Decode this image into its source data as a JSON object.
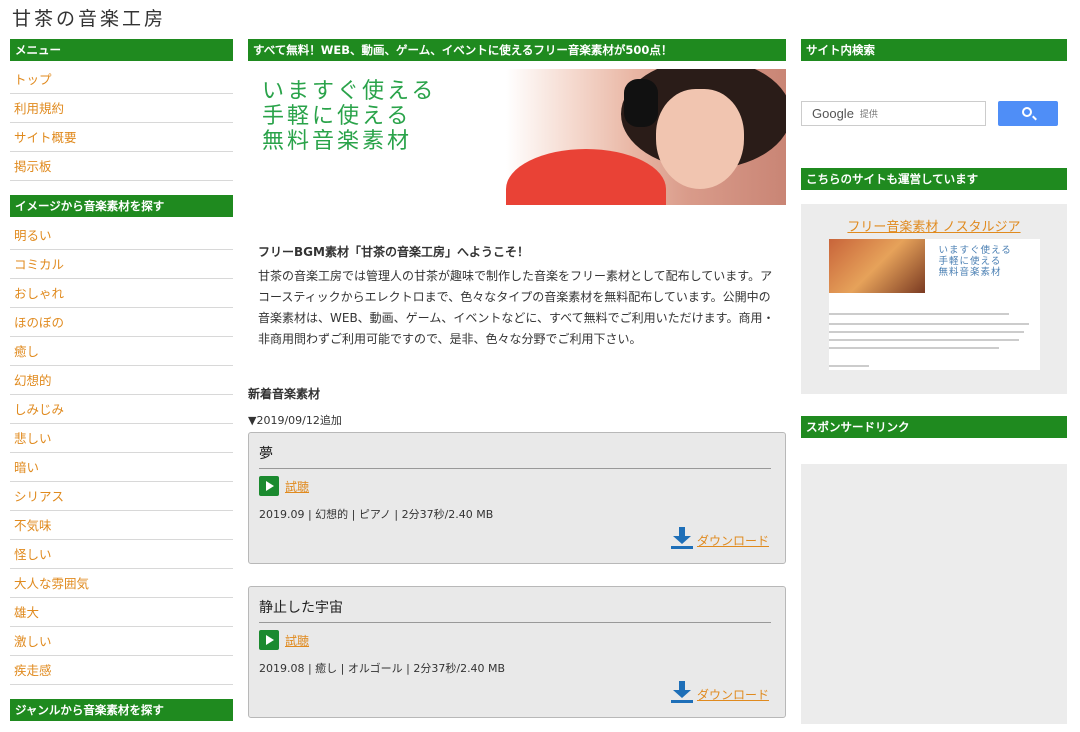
{
  "site": {
    "title": "甘茶の音楽工房"
  },
  "left": {
    "menu_header": "メニュー",
    "menu_items": [
      "トップ",
      "利用規約",
      "サイト概要",
      "掲示板"
    ],
    "image_header": "イメージから音楽素材を探す",
    "image_items": [
      "明るい",
      "コミカル",
      "おしゃれ",
      "ほのぼの",
      "癒し",
      "幻想的",
      "しみじみ",
      "悲しい",
      "暗い",
      "シリアス",
      "不気味",
      "怪しい",
      "大人な雰囲気",
      "雄大",
      "激しい",
      "疾走感"
    ],
    "genre_header": "ジャンルから音楽素材を探す"
  },
  "center": {
    "top_banner": "すべて無料！WEB、動画、ゲーム、イベントに使えるフリー音楽素材が500点！",
    "hero_lines": [
      "いますぐ使える",
      "手軽に使える",
      "無料音楽素材"
    ],
    "welcome_title": "フリーBGM素材「甘茶の音楽工房」へようこそ！",
    "welcome_body": "甘茶の音楽工房では管理人の甘茶が趣味で制作した音楽をフリー素材として配布しています。アコースティックからエレクトロまで、色々なタイプの音楽素材を無料配布しています。公開中の音楽素材は、WEB、動画、ゲーム、イベントなどに、すべて無料でご利用いただけます。商用・非商用問わずご利用可能ですので、是非、色々な分野でご利用下さい。",
    "new_title": "新着音楽素材",
    "date_line": "▼2019/09/12追加",
    "tracks": [
      {
        "title": "夢",
        "listen": "試聴",
        "meta": "2019.09 | 幻想的 | ピアノ | 2分37秒/2.40 MB",
        "download": "ダウンロード"
      },
      {
        "title": "静止した宇宙",
        "listen": "試聴",
        "meta": "2019.08 | 癒し | オルゴール | 2分37秒/2.40 MB",
        "download": "ダウンロード"
      }
    ]
  },
  "right": {
    "search_header": "サイト内検索",
    "search_logo": "Google",
    "search_sub": "提供",
    "sites_header": "こちらのサイトも運営しています",
    "promo_link": "フリー音楽素材 ノスタルジア",
    "promo_thumb_lines": [
      "いますぐ使える",
      "手軽に使える",
      "無料音楽素材"
    ],
    "sponsor_header": "スポンサードリンク"
  },
  "colors": {
    "green": "#1f8a1f",
    "link": "#e08a1e",
    "download_blue": "#1e6fb8",
    "search_blue": "#4f8ef7"
  }
}
